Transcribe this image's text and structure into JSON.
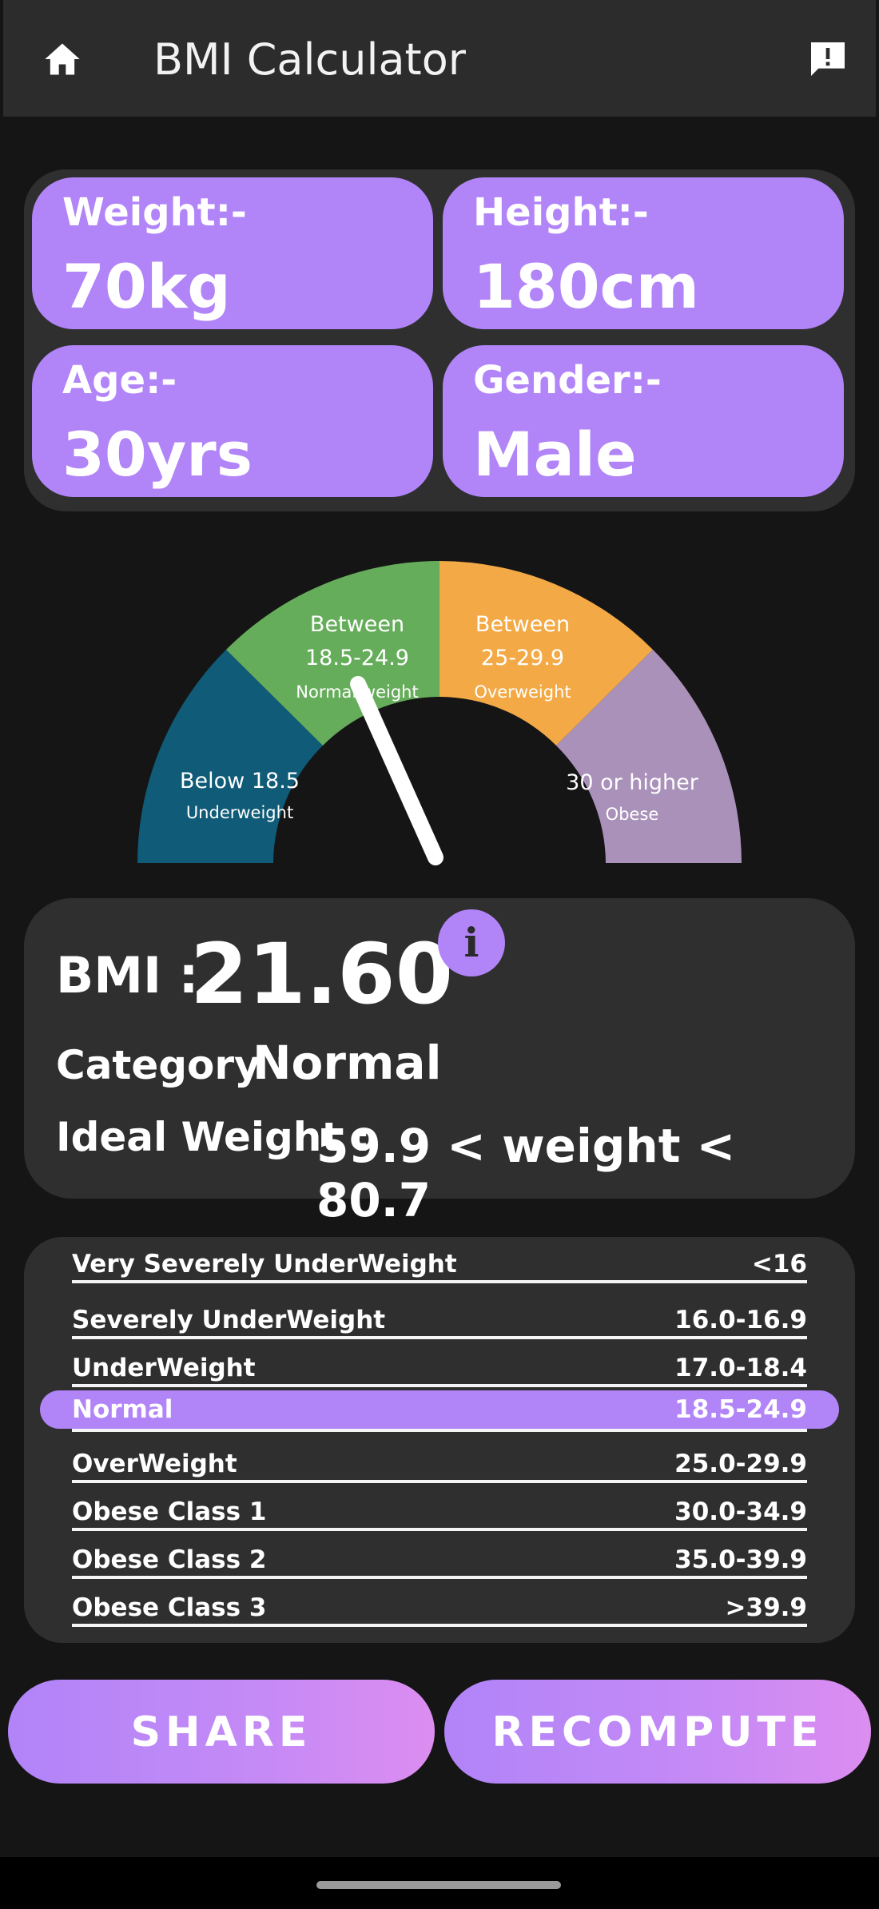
{
  "app_bar": {
    "title": "BMI Calculator",
    "home_icon": "home-icon",
    "feedback_icon": "feedback-icon"
  },
  "inputs": {
    "weight": {
      "label": "Weight:-",
      "value": "70kg"
    },
    "height": {
      "label": "Height:-",
      "value": "180cm"
    },
    "age": {
      "label": "Age:-",
      "value": "30yrs"
    },
    "gender": {
      "label": "Gender:-",
      "value": "Male"
    }
  },
  "gauge": {
    "segments": [
      {
        "range": "Below 18.5",
        "name": "Underweight",
        "color": "#0f5b78"
      },
      {
        "prefix": "Between",
        "range": "18.5-24.9",
        "name": "Normal weight",
        "color": "#66ad5b"
      },
      {
        "prefix": "Between",
        "range": "25-29.9",
        "name": "Overweight",
        "color": "#f3a945"
      },
      {
        "range": "30 or higher",
        "name": "Obese",
        "color": "#a991ba"
      }
    ],
    "needle_value": 21.6
  },
  "result": {
    "bmi_label": "BMI :",
    "bmi_value": "21.60",
    "info_icon": "info-icon",
    "category_label": "Category :",
    "category_value": "Normal",
    "ideal_label": "Ideal Weight :",
    "ideal_value": "59.9 < weight < 80.7"
  },
  "categories": [
    {
      "name": "Very Severely UnderWeight",
      "range": "<16"
    },
    {
      "name": "Severely UnderWeight",
      "range": "16.0-16.9"
    },
    {
      "name": "UnderWeight",
      "range": "17.0-18.4"
    },
    {
      "name": "Normal",
      "range": "18.5-24.9",
      "highlighted": true
    },
    {
      "name": "OverWeight",
      "range": "25.0-29.9"
    },
    {
      "name": "Obese Class 1",
      "range": "30.0-34.9"
    },
    {
      "name": "Obese Class 2",
      "range": "35.0-39.9"
    },
    {
      "name": "Obese Class 3",
      "range": ">39.9"
    }
  ],
  "buttons": {
    "share": "SHARE",
    "recompute": "RECOMPUTE"
  },
  "colors": {
    "accent": "#b184f8",
    "card": "#2f2f2f",
    "background": "#151515"
  }
}
